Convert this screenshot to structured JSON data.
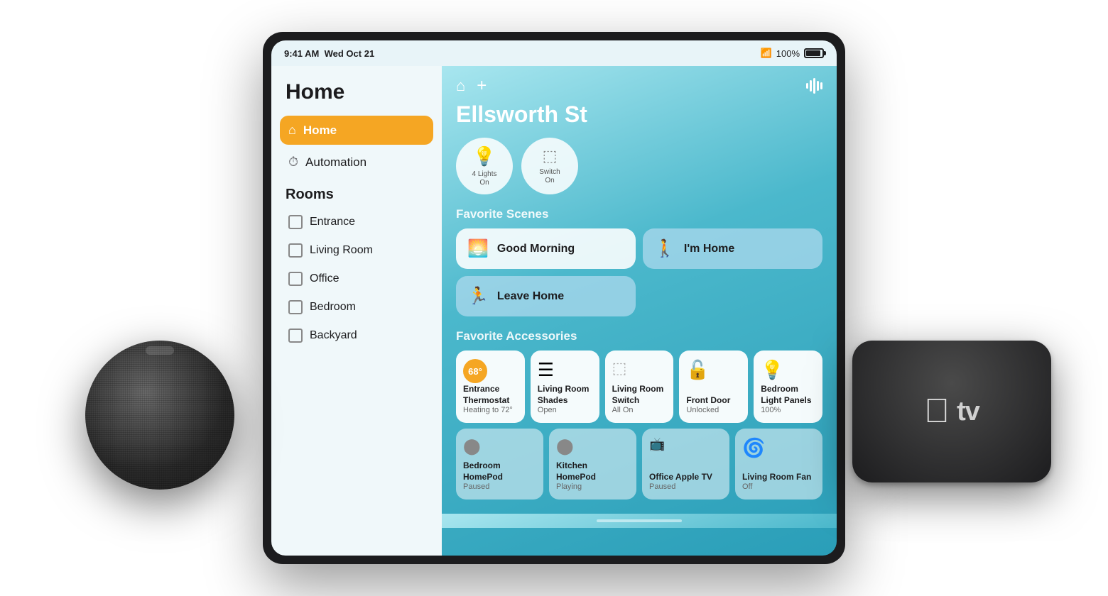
{
  "scene": {
    "background": "#f5f5f7"
  },
  "statusBar": {
    "time": "9:41 AM",
    "date": "Wed Oct 21",
    "wifi": "wifi",
    "battery": "100%"
  },
  "sidebar": {
    "title": "Home",
    "homeLabel": "Home",
    "automationLabel": "Automation",
    "roomsHeader": "Rooms",
    "rooms": [
      {
        "label": "Entrance"
      },
      {
        "label": "Living Room"
      },
      {
        "label": "Office"
      },
      {
        "label": "Bedroom"
      },
      {
        "label": "Backyard"
      }
    ]
  },
  "main": {
    "homeTitle": "Ellsworth St",
    "quickTiles": [
      {
        "icon": "💡",
        "label": "4 Lights\nOn"
      },
      {
        "icon": "⬛",
        "label": "Switch\nOn"
      }
    ],
    "favoriteScenes": {
      "header": "Favorite Scenes",
      "scenes": [
        {
          "icon": "🌅",
          "label": "Good Morning"
        },
        {
          "icon": "🚶",
          "label": "I'm Home"
        },
        {
          "icon": "🏃",
          "label": "Leave Home"
        }
      ]
    },
    "favoriteAccessories": {
      "header": "Favorite Accessories",
      "row1": [
        {
          "icon": "temp",
          "temp": "68°",
          "name": "Entrance Thermostat",
          "status": "Heating to 72°",
          "active": true
        },
        {
          "icon": "🪟",
          "name": "Living Room Shades",
          "status": "Open",
          "active": true
        },
        {
          "icon": "💡",
          "name": "Living Room Switch",
          "status": "All On",
          "active": true
        },
        {
          "icon": "🔓",
          "name": "Front Door",
          "status": "Unlocked",
          "active": true
        },
        {
          "icon": "💡",
          "name": "Bedroom Light Panels",
          "status": "100%",
          "active": true
        }
      ],
      "row2": [
        {
          "icon": "🔊",
          "name": "Bedroom HomePod",
          "status": "Paused",
          "active": false
        },
        {
          "icon": "🔊",
          "name": "Kitchen HomePod",
          "status": "Playing",
          "active": false
        },
        {
          "icon": "📺",
          "name": "Office Apple TV",
          "status": "Paused",
          "active": false
        },
        {
          "icon": "💨",
          "name": "Living Room Fan",
          "status": "Off",
          "active": false
        }
      ]
    }
  }
}
